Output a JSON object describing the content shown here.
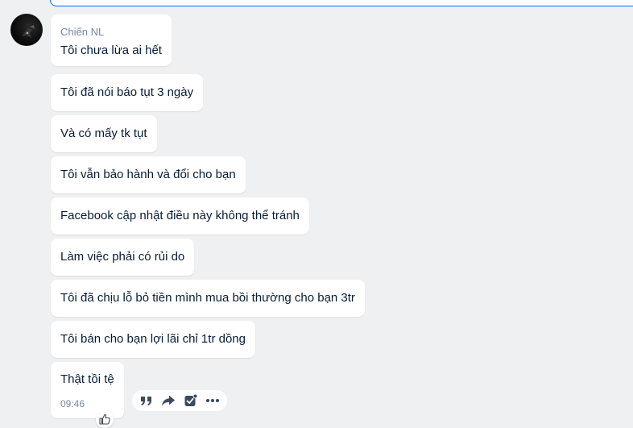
{
  "conversation": {
    "sender_name": "Chiến NL",
    "messages": [
      "Tôi chưa lừa ai hết",
      "Tôi đã nói báo tụt 3 ngày",
      "Và có mấy tk tụt",
      "Tôi vẫn bảo hành và đổi cho bạn",
      "Facebook cập nhật điều này không thể tránh",
      "Làm việc phải có rủi do",
      "Tôi đã chịu lỗ bỏ tiền mình mua bồi thường cho bạn 3tr",
      "Tôi bán cho bạn lợi lãi chỉ 1tr dồng",
      "Thật tồi tệ"
    ],
    "last_message_time": "09:46"
  },
  "icons": {
    "quote": "quote-icon",
    "forward": "forward-icon",
    "task": "task-check-icon",
    "more": "more-options-icon",
    "like": "thumbs-up-icon"
  },
  "colors": {
    "background": "#eef0f1",
    "bubble": "#ffffff",
    "text": "#081c36",
    "meta": "#7589a3",
    "accent": "#0068ff"
  }
}
